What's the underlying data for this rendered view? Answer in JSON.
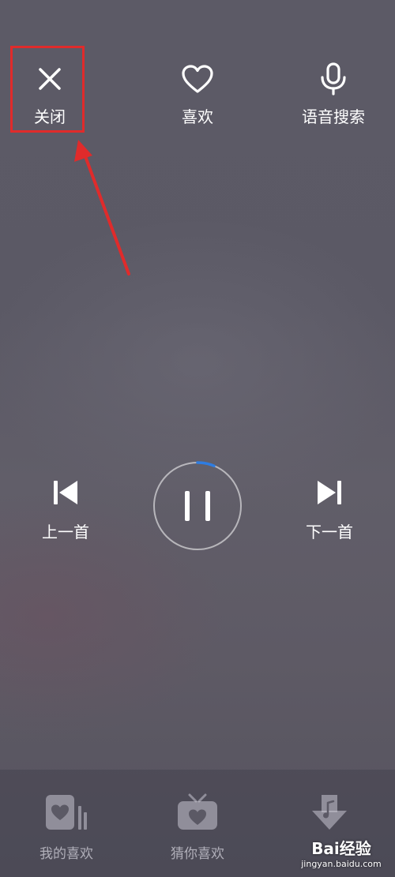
{
  "top_bar": {
    "close_label": "关闭",
    "like_label": "喜欢",
    "voice_search_label": "语音搜索"
  },
  "song": {
    "title": "",
    "artist": ""
  },
  "controls": {
    "prev_label": "上一首",
    "next_label": "下一首",
    "playback_state": "playing"
  },
  "bottom_nav": {
    "items": [
      {
        "label": "我的喜欢",
        "icon": "heart-card-icon"
      },
      {
        "label": "猜你喜欢",
        "icon": "radio-heart-icon"
      },
      {
        "label": "",
        "icon": "download-icon"
      }
    ]
  },
  "watermark": {
    "brand": "Bai经验",
    "url": "jingyan.baidu.com"
  },
  "colors": {
    "highlight": "#e02b2b",
    "progress": "#2f7de1",
    "text": "#ffffff"
  }
}
